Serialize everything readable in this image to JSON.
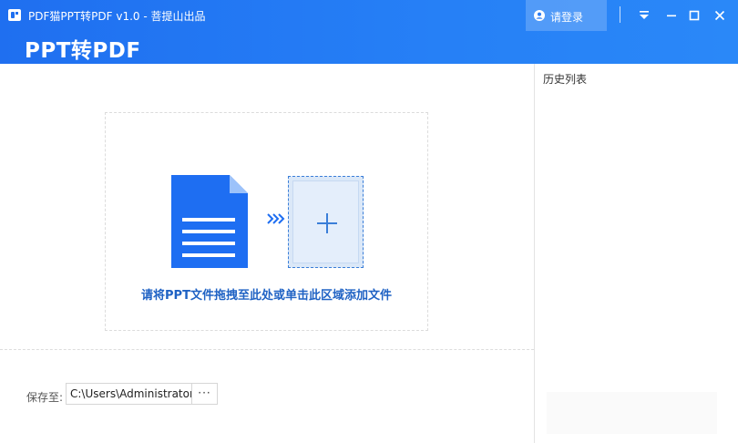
{
  "window": {
    "title": "PDF猫PPT转PDF v1.0 - 菩提山出品",
    "login_label": "请登录",
    "icons": {
      "app": "app-logo-icon",
      "user": "user-icon",
      "menu": "menu-dropdown-icon",
      "minimize": "minimize-icon",
      "maximize": "maximize-icon",
      "close": "close-icon"
    }
  },
  "header": {
    "page_title": "PPT转PDF"
  },
  "drop_zone": {
    "hint": "请将PPT文件拖拽至此处或单击此区域添加文件",
    "icons": {
      "document": "document-icon",
      "arrows": "triple-chevron-right-icon",
      "add": "plus-icon"
    }
  },
  "output": {
    "save_label": "保存至:",
    "path_value": "C:\\Users\\Administrator",
    "browse_label": "···"
  },
  "history": {
    "title": "历史列表"
  },
  "colors": {
    "header_start": "#1f6ff0",
    "header_end": "#2a88f8",
    "doc_blue": "#1e6ef2",
    "hint_text": "#1f62c4",
    "add_box_bg": "#dbe8f8"
  }
}
